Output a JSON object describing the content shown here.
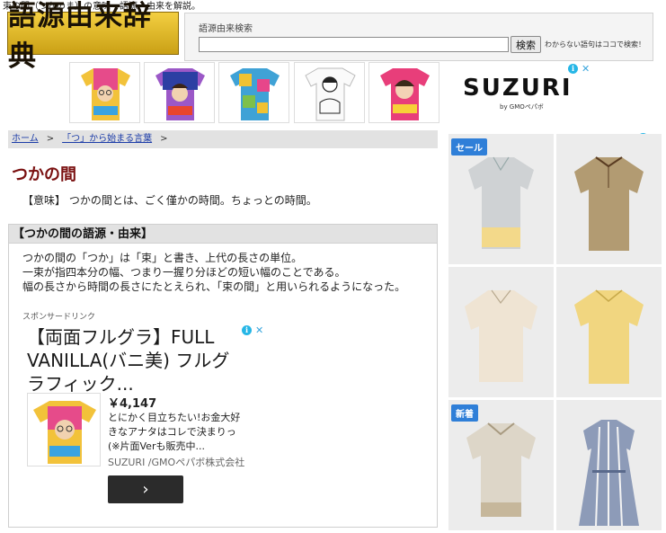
{
  "header": {
    "tagline": "束の間（つかのま）の意味・語源・由来を解説。",
    "logo_text": "語源由来辞典"
  },
  "search": {
    "label": "語源由来検索",
    "value": "",
    "placeholder": "",
    "button_label": "検索",
    "note": "わからない語句はココで検索！"
  },
  "top_ad": {
    "brand": "SUZURI",
    "sub": "by GMOペパボ",
    "info_glyph": "i",
    "close_glyph": "✕"
  },
  "breadcrumb": {
    "home": "ホーム",
    "sep": ">",
    "category": "「つ」から始まる言葉"
  },
  "entry": {
    "title": "つかの間",
    "meaning": "【意味】 つかの間とは、ごく僅かの時間。ちょっとの時間。",
    "origin_heading": "【つかの間の語源・由来】",
    "origin_lines": [
      "つかの間の「つか」は「束」と書き、上代の長さの単位。",
      "一束が指四本分の幅、つまり一握り分ほどの短い幅のことである。",
      "幅の長さから時間の長さにたとえられ、「束の間」と用いられるようになった。"
    ]
  },
  "sponsored": {
    "label": "スポンサードリンク",
    "title": "【両面フルグラ】FULL VANILLA(バニ美) フルグラフィック...",
    "price": "￥4,147",
    "desc_lines": [
      "とにかく目立ちたい!お金大好",
      "きなアナタはコレで決まりっ",
      "(※片面Verも販売中..."
    ],
    "seller": "SUZURI /GMOペパボ株式会社",
    "button_glyph": "›"
  },
  "side_ad": {
    "badge_sale": "セール",
    "badge_new": "新着"
  },
  "colors": {
    "title": "#7a1010",
    "link": "#1c3ca8",
    "logo_gold": "#f3cf41",
    "ad_badge": "#2f7fd8",
    "ad_info": "#26b6e6"
  }
}
